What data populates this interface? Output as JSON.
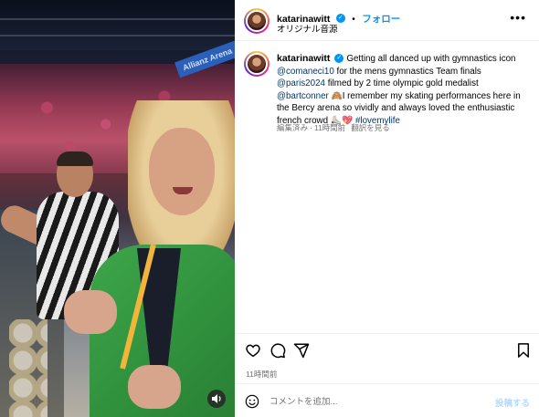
{
  "media": {
    "banner_text": "Allianz Arena",
    "sound_icon": "speaker-icon"
  },
  "header": {
    "username": "katarinawitt",
    "separator": "•",
    "follow_label": "フォロー",
    "audio_label": "オリジナル音源",
    "more_label": "•••"
  },
  "caption": {
    "username": "katarinawitt",
    "text_1": "Getting all danced up with gymnastics icon",
    "mention_1": "@comaneci10",
    "text_2": " for the mens gymnastics Team finals ",
    "mention_2": "@paris2024",
    "text_3": " filmed by 2 time olympic gold medalist ",
    "mention_3": "@bartconner",
    "text_4": " 🙈I remember my skating performances here in the Bercy arena so vividly and always loved the enthusiastic french crowd ⛸️💖 ",
    "hashtag": "#lovemylife"
  },
  "meta": {
    "edited": "編集済み",
    "dot": "·",
    "time": "11時間前",
    "translate": "翻訳を見る"
  },
  "footer": {
    "timestamp": "11時間前",
    "comment_placeholder": "コメントを追加...",
    "post_label": "投稿する"
  },
  "colors": {
    "accent": "#0095f6",
    "mention": "#00376b",
    "muted": "#737373",
    "post_disabled": "#b3dbff"
  }
}
